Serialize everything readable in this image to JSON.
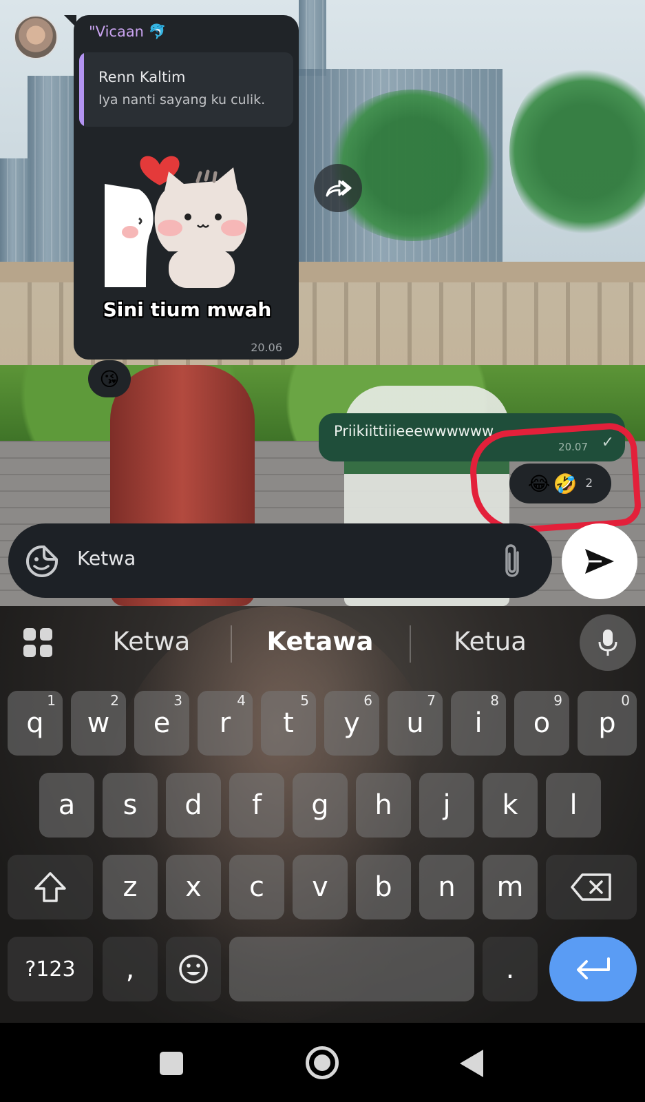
{
  "chat": {
    "incoming": {
      "sender": "\"Vicaan 🐬",
      "reply": {
        "name": "Renn Kaltim",
        "text": "Iya nanti sayang ku culik."
      },
      "sticker_caption": "Sini tium mwah",
      "time": "20.06",
      "reaction": "😘"
    },
    "outgoing": {
      "text": "Priikiittiiieeewwwwww",
      "time": "20.07",
      "status_icon": "double-check-icon",
      "reactions": [
        "😂",
        "🤣"
      ],
      "reaction_count": "2"
    }
  },
  "composer": {
    "text": "Ketwa"
  },
  "keyboard": {
    "suggestions": [
      "Ketwa",
      "Ketawa",
      "Ketua"
    ],
    "row1": [
      {
        "key": "q",
        "num": "1"
      },
      {
        "key": "w",
        "num": "2"
      },
      {
        "key": "e",
        "num": "3"
      },
      {
        "key": "r",
        "num": "4"
      },
      {
        "key": "t",
        "num": "5"
      },
      {
        "key": "y",
        "num": "6"
      },
      {
        "key": "u",
        "num": "7"
      },
      {
        "key": "i",
        "num": "8"
      },
      {
        "key": "o",
        "num": "9"
      },
      {
        "key": "p",
        "num": "0"
      }
    ],
    "row2": [
      "a",
      "s",
      "d",
      "f",
      "g",
      "h",
      "j",
      "k",
      "l"
    ],
    "row3": [
      "z",
      "x",
      "c",
      "v",
      "b",
      "n",
      "m"
    ],
    "symbols_label": "?123",
    "comma_label": ",",
    "period_label": ".",
    "enter_color": "#5a9cf4"
  },
  "colors": {
    "incoming_bubble": "#202428",
    "outgoing_bubble": "#1f4e3a",
    "sender_name": "#c9a3f0",
    "reply_bar": "#b394f1",
    "highlight": "#e3203a"
  }
}
